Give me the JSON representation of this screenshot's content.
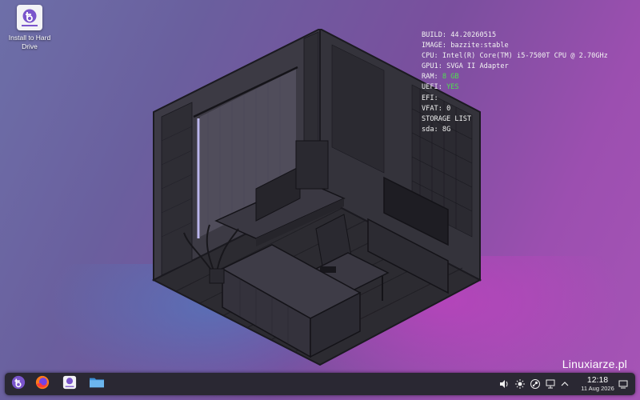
{
  "desktop": {
    "icons": [
      {
        "label": "Install to Hard Drive",
        "icon": "bazzite-installer-icon"
      }
    ]
  },
  "sysinfo": {
    "lines": [
      {
        "key": "BUILD:",
        "value": "44.20260515"
      },
      {
        "key": "IMAGE:",
        "value": "bazzite:stable"
      },
      {
        "key": "CPU:",
        "value": "Intel(R) Core(TM) i5-7500T CPU @ 2.70GHz"
      },
      {
        "key": "GPU1:",
        "value": "SVGA II Adapter"
      },
      {
        "key": "RAM:",
        "value": "8 GB"
      },
      {
        "key": "UEFI:",
        "value": "YES"
      },
      {
        "key": "EFI:",
        "value": ""
      },
      {
        "key": "VFAT:",
        "value": "0"
      },
      {
        "key": "STORAGE LIST",
        "value": ""
      },
      {
        "key": "sda:",
        "value": "8G"
      }
    ],
    "highlight_color": "#4fe04f"
  },
  "watermark": "Linuxiarze.pl",
  "taskbar": {
    "apps": [
      {
        "name": "application-launcher",
        "icon": "bazzite-logo-icon"
      },
      {
        "name": "firefox",
        "icon": "firefox-icon"
      },
      {
        "name": "installer",
        "icon": "installer-icon"
      },
      {
        "name": "file-manager",
        "icon": "folder-icon"
      }
    ],
    "tray": [
      {
        "name": "volume",
        "icon": "speaker-icon"
      },
      {
        "name": "brightness",
        "icon": "brightness-icon"
      },
      {
        "name": "steam",
        "icon": "steam-icon"
      },
      {
        "name": "network",
        "icon": "network-icon"
      },
      {
        "name": "expand",
        "icon": "chevron-up-icon"
      }
    ],
    "clock": {
      "time": "12:18",
      "date": "11 Aug 2026"
    },
    "show_desktop_icon": "show-desktop-icon"
  },
  "colors": {
    "taskbar_bg": "#2a2833",
    "accent": "#7a55cc"
  }
}
